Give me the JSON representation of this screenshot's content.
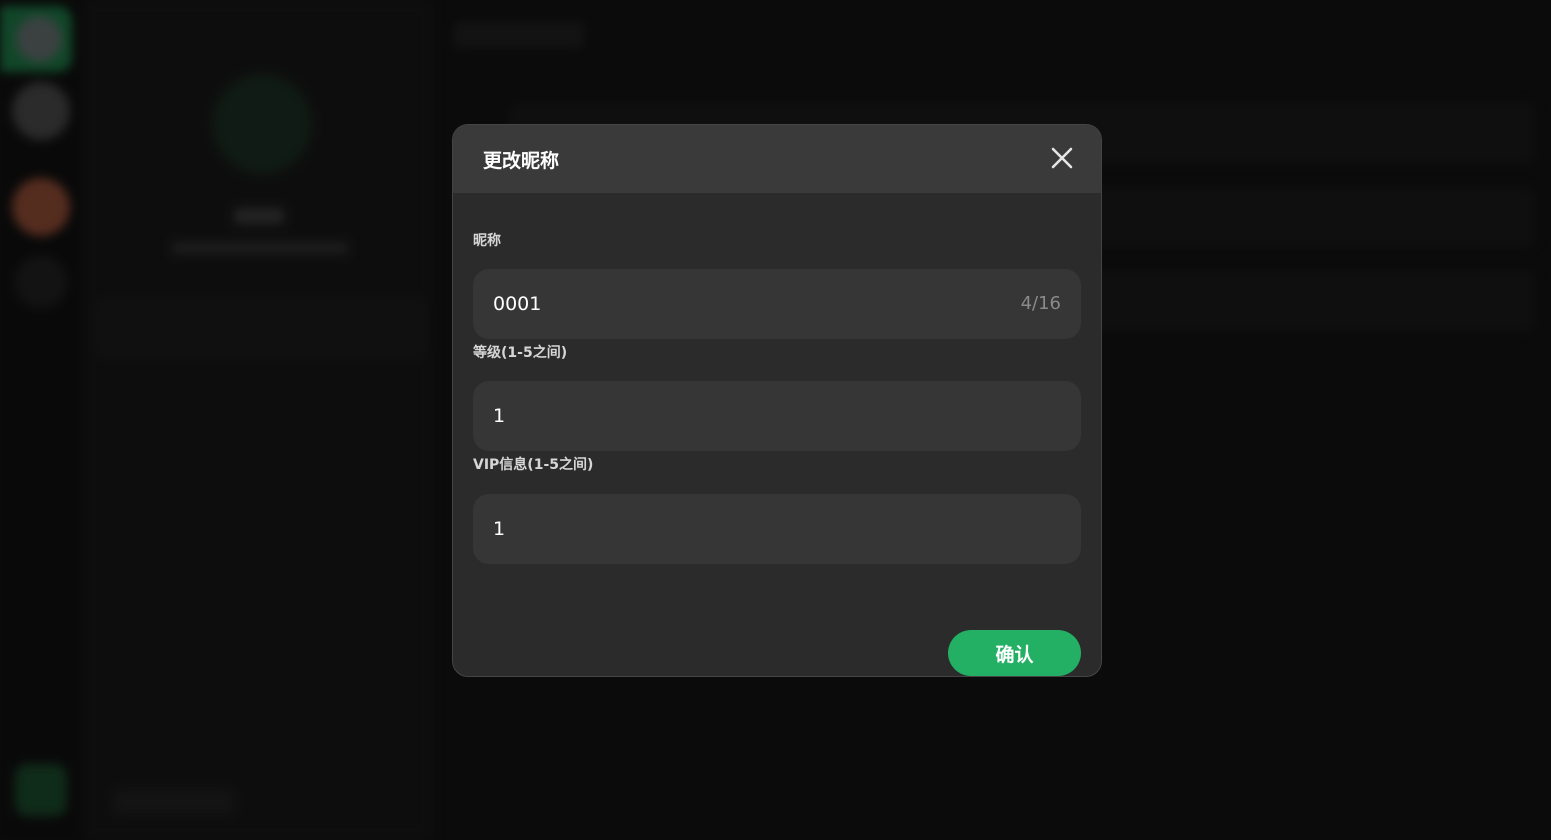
{
  "dialog": {
    "title": "更改昵称",
    "close_icon": "close-icon",
    "fields": [
      {
        "label": "昵称",
        "value": "0001",
        "counter": "4/16"
      },
      {
        "label": "等级(1-5之间)",
        "value": "1"
      },
      {
        "label": "VIP信息(1-5之间)",
        "value": "1"
      }
    ],
    "confirm_label": "确认"
  },
  "colors": {
    "accent": "#23b064",
    "dialog_bg": "#2b2b2b",
    "header_bg": "#3a3a3a",
    "input_bg": "#363636"
  }
}
